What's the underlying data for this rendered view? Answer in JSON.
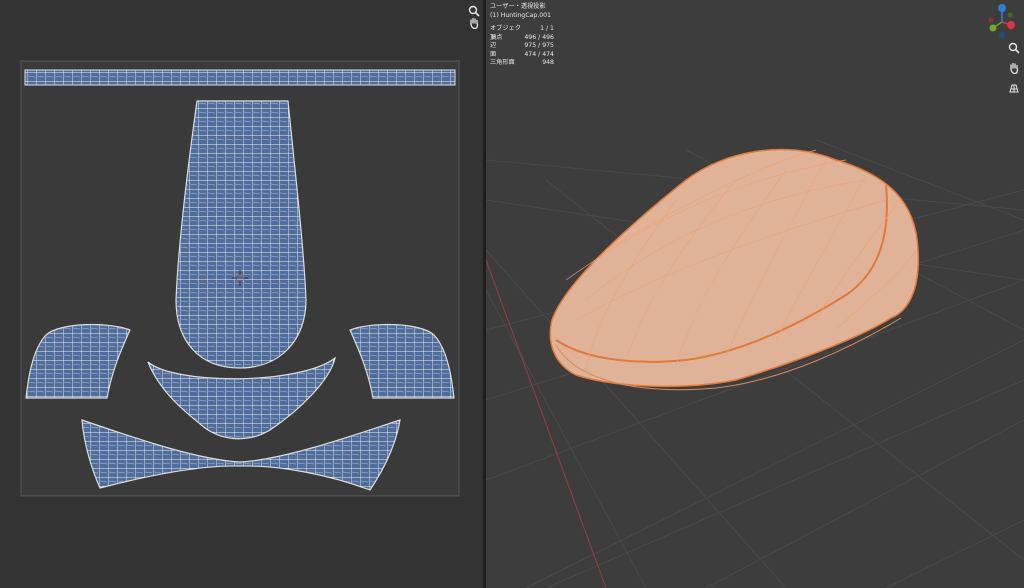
{
  "uv_editor": {
    "nav_icons": [
      "zoom-icon",
      "hand-pan-icon"
    ],
    "island_fill": "#4f6c9a",
    "wire_color": "#e8e8e8",
    "bounds_color": "#5a5a5a"
  },
  "viewport": {
    "overlay": {
      "view_name": "ユーザー・透視投影",
      "object_name": "(1) HuntingCap.001",
      "stats": [
        {
          "label": "オブジェクト",
          "value": "1 / 1"
        },
        {
          "label": "頂点",
          "value": "496 / 496"
        },
        {
          "label": "辺",
          "value": "975 / 975"
        },
        {
          "label": "面",
          "value": "474 / 474"
        },
        {
          "label": "三角形面",
          "value": "948"
        }
      ]
    },
    "gizmo_axes": {
      "z": {
        "label": "Z",
        "color": "#2f7fd6"
      },
      "y": {
        "label": "Y",
        "color": "#6fa82c"
      },
      "x": {
        "label": "X",
        "color": "#d9344a"
      }
    },
    "nav_icons": [
      "zoom-icon",
      "hand-pan-icon",
      "grid-view-icon"
    ],
    "mesh_fill": "#e0b398",
    "mesh_edge": "#e07a3a",
    "grid_color": "#4a4a4a"
  }
}
